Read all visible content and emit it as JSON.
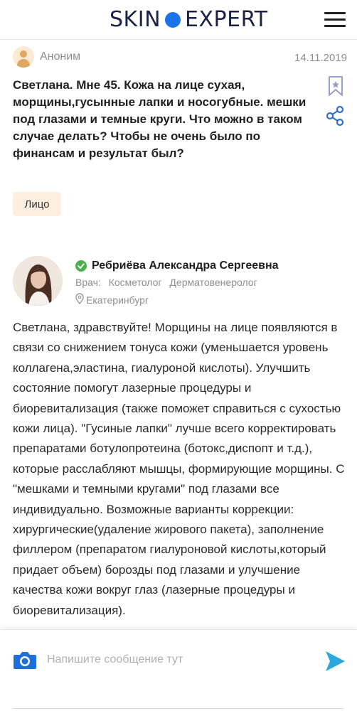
{
  "header": {
    "logo_left": "SKIN",
    "logo_right": "EXPERT",
    "brand_color": "#1a73e8",
    "menu_icon": "hamburger-icon"
  },
  "question": {
    "author": "Аноним",
    "date": "14.11.2019",
    "text": "Светлана. Мне 45. Кожа на лице сухая, морщины,гусынные лапки и носогубные. мешки под глазами и темные круги. Что можно в таком случае делать? Чтобы не очень было по финансам и результат был?",
    "tag": "Лицо",
    "icons": [
      "bookmark-icon",
      "share-icon"
    ]
  },
  "answer": {
    "doctor_name": "Ребриёва Александра Сергеевна",
    "roles": [
      "Врач:",
      "Косметолог",
      "Дерматовенеролог"
    ],
    "city": "Екатеринбург",
    "text": "Светлана, здравствуйте! Морщины на лице появляются в связи со снижением тонуса кожи (уменьшается уровень коллагена,эластина, гиалуроной кислоты). Улучшить состояние помогут лазерные процедуры и биоревитализация (также поможет справиться с сухостью кожи лица). \"Гусиные лапки\" лучше всего корректировать препаратами ботулопротеина (ботокс,диспопт и т.д.), которые расслабляют мышцы, формирующие морщины. С \"мешками и темными кругами\" под глазами все индивидуально. Возможные варианты коррекции: хирургические(удаление жирового пакета), заполнение филлером (препаратом гиалуроновой кислоты,который придает объем) борозды под глазами и улучшение качества кожи вокруг глаз (лазерные процедуры и биоревитализация)."
  },
  "compose": {
    "placeholder": "Напишите сообщение тут",
    "camera_icon": "camera-icon",
    "send_icon": "send-icon",
    "accent": "#29a8e0"
  }
}
